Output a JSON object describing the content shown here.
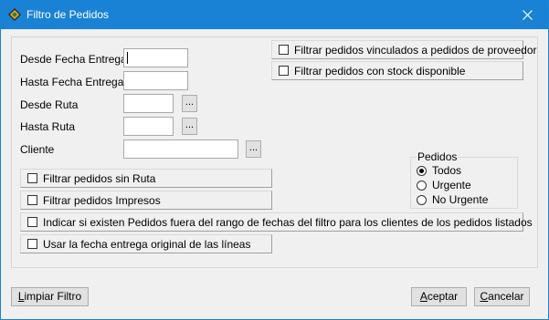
{
  "window": {
    "title": "Filtro de Pedidos",
    "close_symbol": "✕"
  },
  "fields": {
    "desde_fecha_entrega": {
      "label": "Desde Fecha Entrega",
      "value": ""
    },
    "hasta_fecha_entrega": {
      "label": "Hasta Fecha Entrega",
      "value": ""
    },
    "desde_ruta": {
      "label": "Desde Ruta",
      "value": ""
    },
    "hasta_ruta": {
      "label": "Hasta Ruta",
      "value": ""
    },
    "cliente": {
      "label": "Cliente",
      "value": ""
    },
    "browse_label": "..."
  },
  "checkboxes": {
    "vinculados_proveedor": {
      "label": "Filtrar pedidos vinculados a pedidos de proveedor",
      "checked": false
    },
    "stock_disponible": {
      "label": "Filtrar pedidos con stock disponible",
      "checked": false
    },
    "sin_ruta": {
      "label": "Filtrar pedidos sin Ruta",
      "checked": false
    },
    "impresos": {
      "label": "Filtrar pedidos Impresos",
      "checked": false
    },
    "fuera_rango": {
      "label": "Indicar si existen Pedidos fuera del rango de fechas del filtro para los clientes de los pedidos listados",
      "checked": false
    },
    "fecha_original": {
      "label": "Usar la fecha entrega original de las líneas",
      "checked": false
    }
  },
  "pedidos_group": {
    "title": "Pedidos",
    "options": [
      "Todos",
      "Urgente",
      "No Urgente"
    ],
    "selected": "Todos"
  },
  "buttons": {
    "limpiar": {
      "first": "L",
      "rest": "impiar Filtro"
    },
    "aceptar": {
      "first": "A",
      "rest": "ceptar"
    },
    "cancelar": {
      "first": "C",
      "rest": "ancelar"
    }
  },
  "icons": {
    "app_icon": "app-tool-icon",
    "close_icon": "close-icon"
  },
  "colors": {
    "titlebar": "#1a82d4",
    "dialog_bg": "#f0f0f0"
  }
}
